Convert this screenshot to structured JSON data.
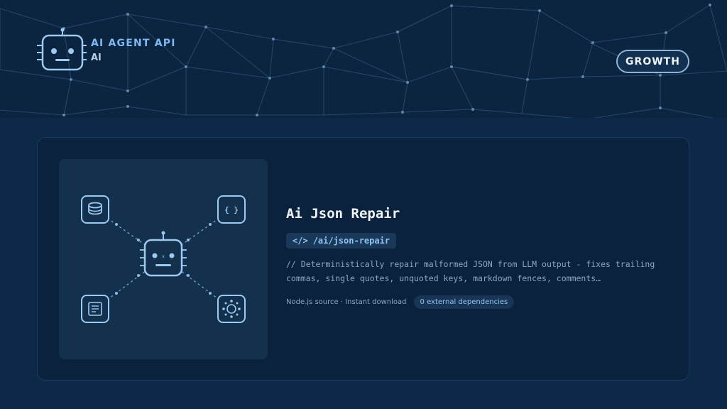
{
  "header": {
    "brand_title": "AI AGENT API",
    "brand_sub": "AI",
    "growth_label": "GROWTH"
  },
  "card": {
    "title": "Ai Json Repair",
    "endpoint": "/ai/json-repair",
    "description_line1": "// Deterministically repair malformed JSON from LLM output - fixes trailing",
    "description_line2": "commas, single quotes, unquoted keys, markdown fences, comments…",
    "meta_text": "Node.js source · Instant download",
    "deps_badge": "0 external dependencies",
    "illustration": {
      "nodes": [
        "database-icon",
        "json-braces-icon",
        "document-icon",
        "network-hub-icon"
      ],
      "center": "robot-icon",
      "braces_text": "{ }"
    }
  },
  "colors": {
    "background": "#0c2a48",
    "header_bg": "#0b2541",
    "card_bg": "#0a223d",
    "accent": "#7fb8f0",
    "badge_text": "#8fc4f2"
  }
}
